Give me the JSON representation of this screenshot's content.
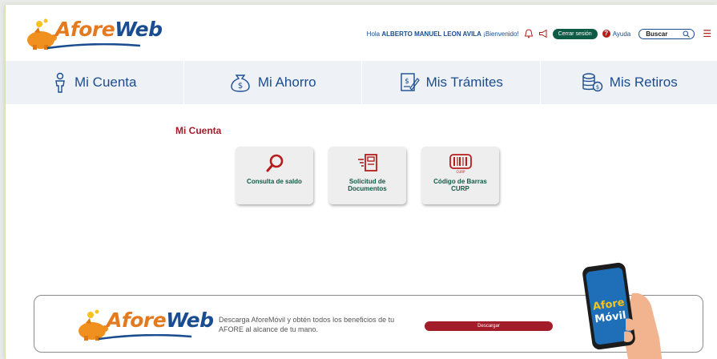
{
  "header": {
    "logo": {
      "part1": "Afore",
      "part2": "Web"
    },
    "greeting_prefix": "Hola",
    "user_name": "ALBERTO MANUEL LEON AVILA",
    "greeting_suffix": "¡Bienvenido!",
    "logout_label": "Cerrar sesión",
    "help_symbol": "?",
    "help_label": "Ayuda",
    "search_label": "Buscar",
    "icons": [
      "bell-icon",
      "megaphone-icon",
      "help-icon",
      "search-icon",
      "menu-icon"
    ]
  },
  "nav": {
    "items": [
      {
        "label": "Mi Cuenta",
        "icon": "person-icon"
      },
      {
        "label": "Mi Ahorro",
        "icon": "money-bag-icon"
      },
      {
        "label": "Mis Trámites",
        "icon": "document-edit-icon"
      },
      {
        "label": "Mis Retiros",
        "icon": "coins-icon"
      }
    ]
  },
  "main": {
    "section_title": "Mi Cuenta",
    "cards": [
      {
        "label": "Consulta de saldo",
        "icon": "magnifier-icon"
      },
      {
        "label": "Solicitud de Documentos",
        "icon": "document-send-icon"
      },
      {
        "label": "Código de Barras CURP",
        "icon": "barcode-icon"
      }
    ]
  },
  "banner": {
    "logo": {
      "part1": "Afore",
      "part2": "Web"
    },
    "text": "Descarga AforeMóvil y obtén todos los beneficios de tu AFORE al alcance de tu mano.",
    "button_label": "Descargar",
    "phone_logo": {
      "line1": "Afore",
      "line2": "Móvil"
    }
  },
  "colors": {
    "brand_orange": "#e47a1f",
    "brand_blue": "#1a4d8f",
    "accent_red": "#a31c2a",
    "accent_green": "#0e5b45",
    "nav_bg": "#eef2f7"
  }
}
